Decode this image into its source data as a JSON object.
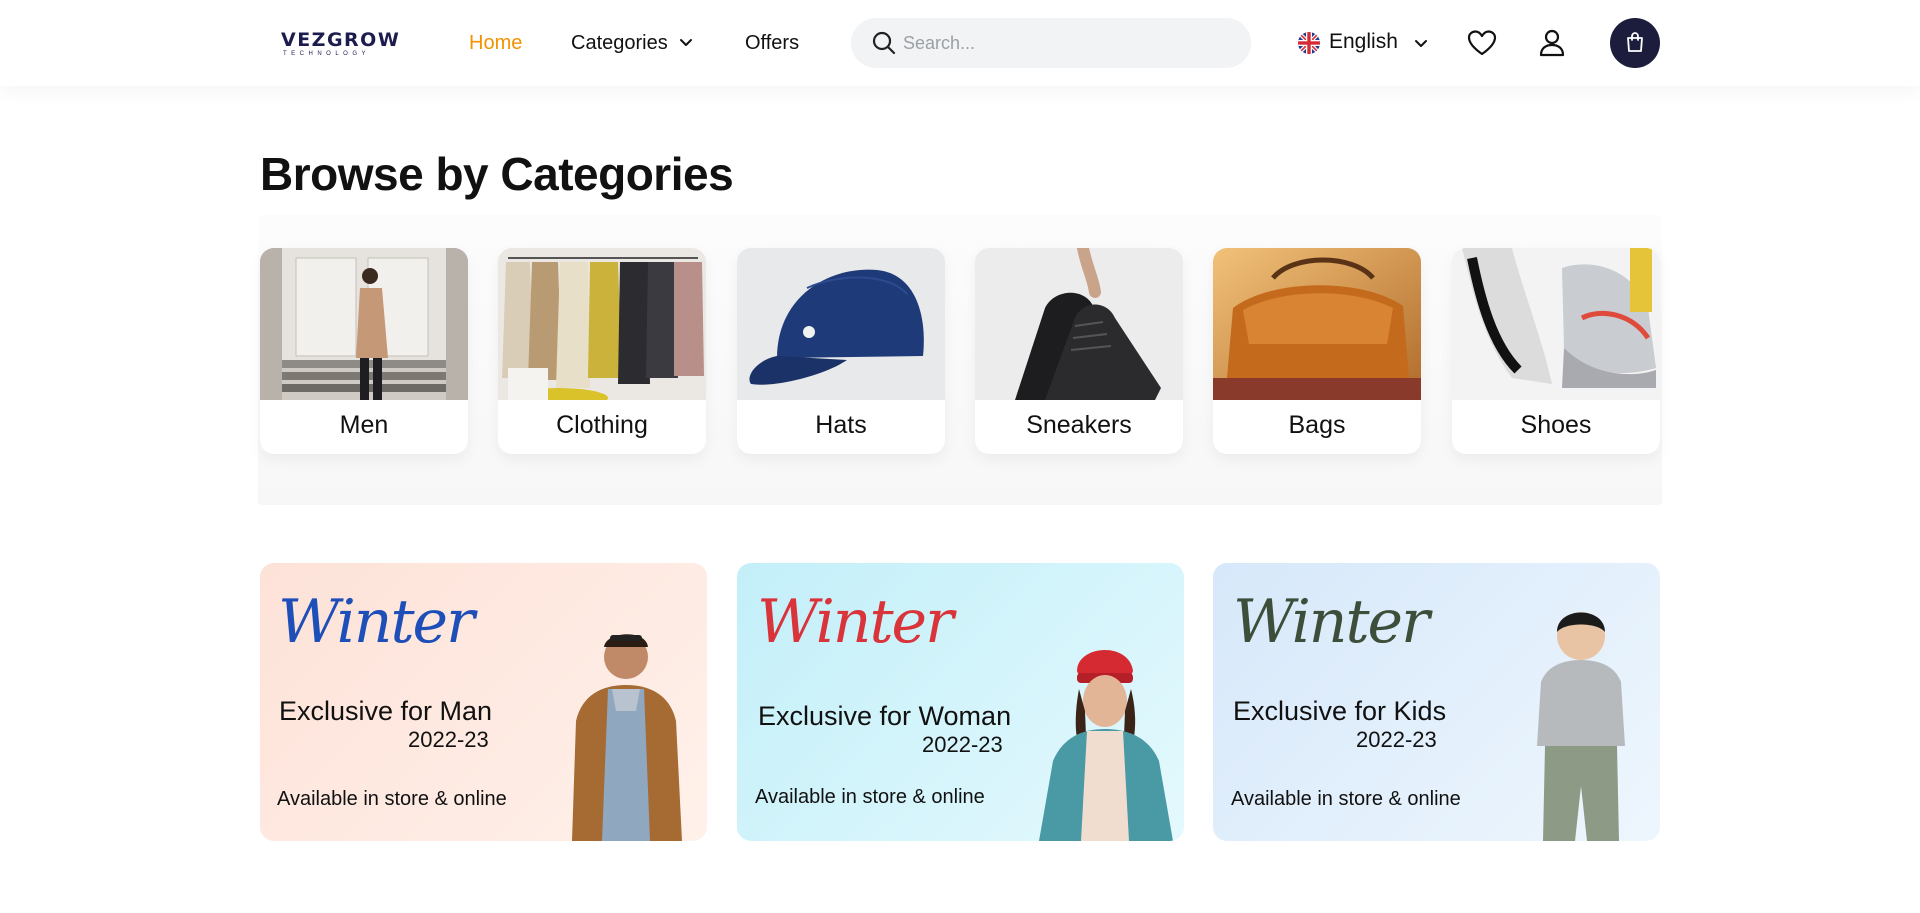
{
  "header": {
    "logo": {
      "name": "VEZGROW",
      "tagline": "TECHNOLOGY"
    },
    "nav": {
      "home": "Home",
      "categories": "Categories",
      "offers": "Offers"
    },
    "search": {
      "placeholder": "Search..."
    },
    "language": {
      "label": "English",
      "flag_icon": "uk-flag-icon"
    },
    "icons": [
      "heart-icon",
      "user-icon",
      "shopping-bag-icon"
    ],
    "colors": {
      "active_nav": "#f39200",
      "cart_button": "#1c1c3c"
    }
  },
  "section": {
    "title": "Browse by Categories"
  },
  "categories": [
    {
      "label": "Men"
    },
    {
      "label": "Clothing"
    },
    {
      "label": "Hats"
    },
    {
      "label": "Sneakers"
    },
    {
      "label": "Bags"
    },
    {
      "label": "Shoes"
    }
  ],
  "banners": [
    {
      "script": "Winter",
      "title": "Exclusive for Man",
      "year": "2022-23",
      "availability": "Available in store & online",
      "script_color": "#1e4fb8",
      "background": "#fde8e0"
    },
    {
      "script": "Winter",
      "title": "Exclusive for Woman",
      "year": "2022-23",
      "availability": "Available in store & online",
      "script_color": "#d9343a",
      "background": "#c8f1f9"
    },
    {
      "script": "Winter",
      "title": "Exclusive for Kids",
      "year": "2022-23",
      "availability": "Available in store & online",
      "script_color": "#3d4f3a",
      "background": "#dcebfb"
    }
  ]
}
